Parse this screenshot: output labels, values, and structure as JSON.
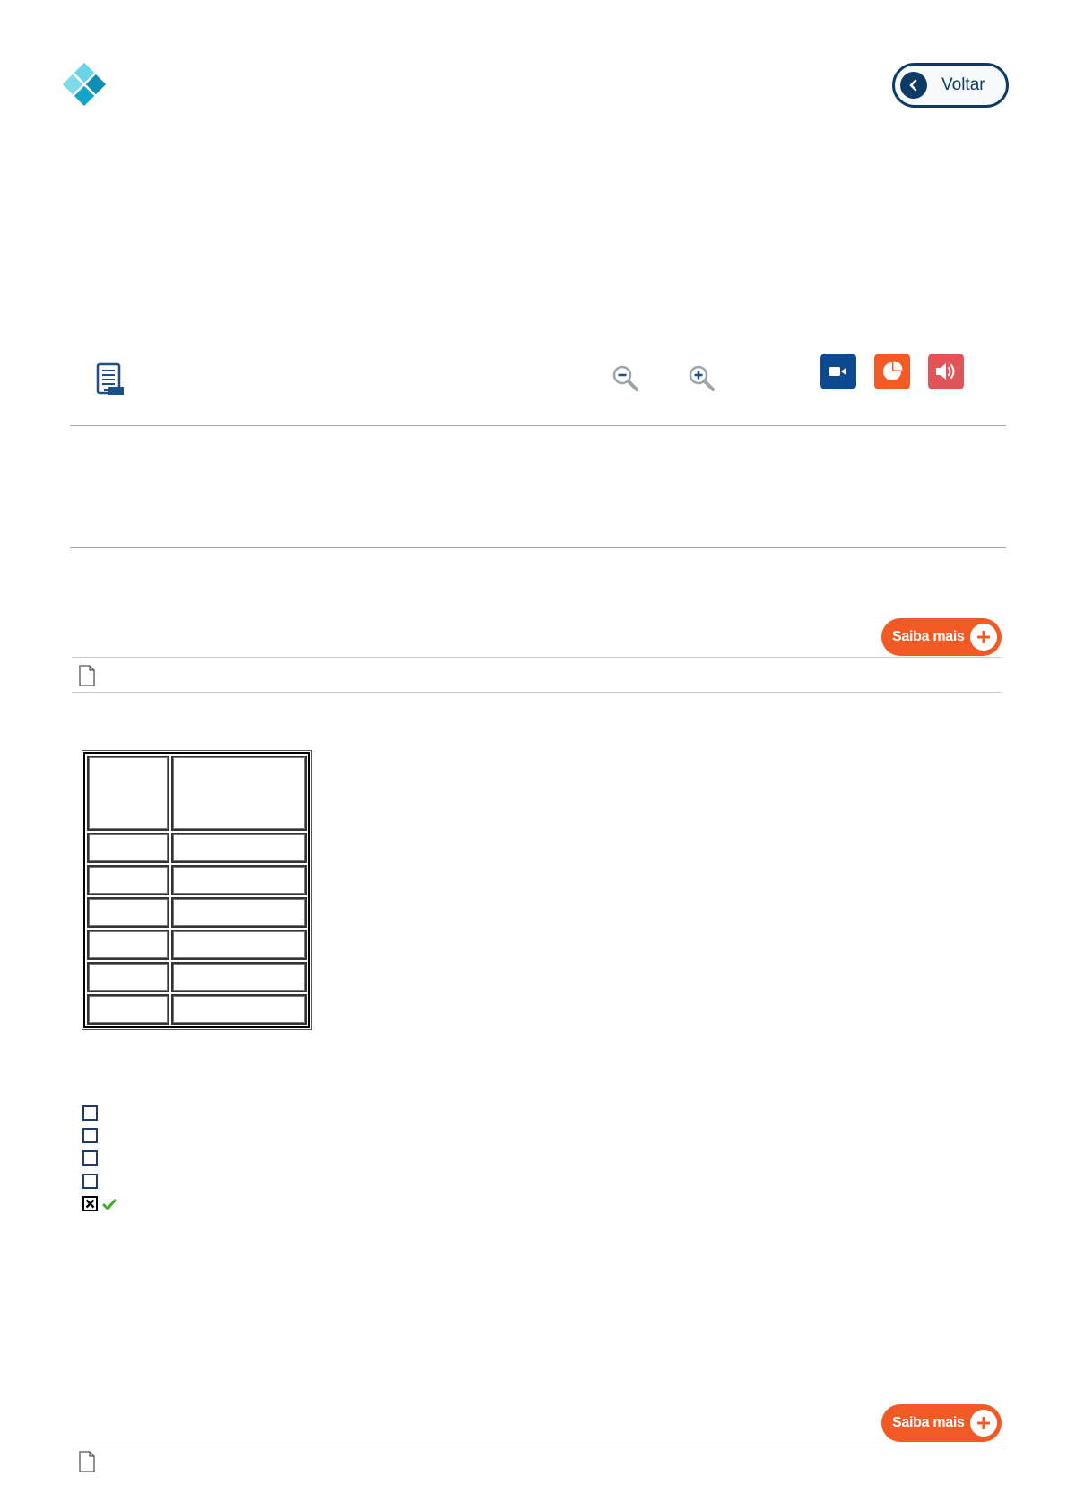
{
  "header": {
    "logo_icon": "diamond-grid-logo",
    "back_button": {
      "label": "Voltar",
      "icon": "chevron-left-icon"
    }
  },
  "toolbar": {
    "notes_icon": "notebook-icon",
    "zoom_out_icon": "zoom-out-icon",
    "zoom_in_icon": "zoom-in-icon",
    "media": [
      {
        "name": "video",
        "icon": "video-camera-icon",
        "color": "#0d4a8f"
      },
      {
        "name": "chart",
        "icon": "pie-chart-icon",
        "color": "#f15a24"
      },
      {
        "name": "audio",
        "icon": "speaker-icon",
        "color": "#e0555a"
      }
    ]
  },
  "sections": [
    {
      "saiba_mais_label": "Saiba mais",
      "attachment_icon": "document-icon"
    },
    {
      "saiba_mais_label": "Saiba mais",
      "attachment_icon": "document-icon"
    }
  ],
  "table": {
    "header": [
      "",
      ""
    ],
    "rows": [
      [
        "",
        ""
      ],
      [
        "",
        ""
      ],
      [
        "",
        ""
      ],
      [
        "",
        ""
      ],
      [
        "",
        ""
      ],
      [
        "",
        ""
      ]
    ]
  },
  "options": [
    {
      "checked": false,
      "correct": false
    },
    {
      "checked": false,
      "correct": false
    },
    {
      "checked": false,
      "correct": false
    },
    {
      "checked": false,
      "correct": false
    },
    {
      "checked": true,
      "correct": true
    }
  ],
  "colors": {
    "brand_dark": "#0d3b66",
    "accent_orange": "#f15a24",
    "audio_red": "#e0555a",
    "video_blue": "#0d4a8f",
    "logo_teal": "#1fb5d6"
  }
}
